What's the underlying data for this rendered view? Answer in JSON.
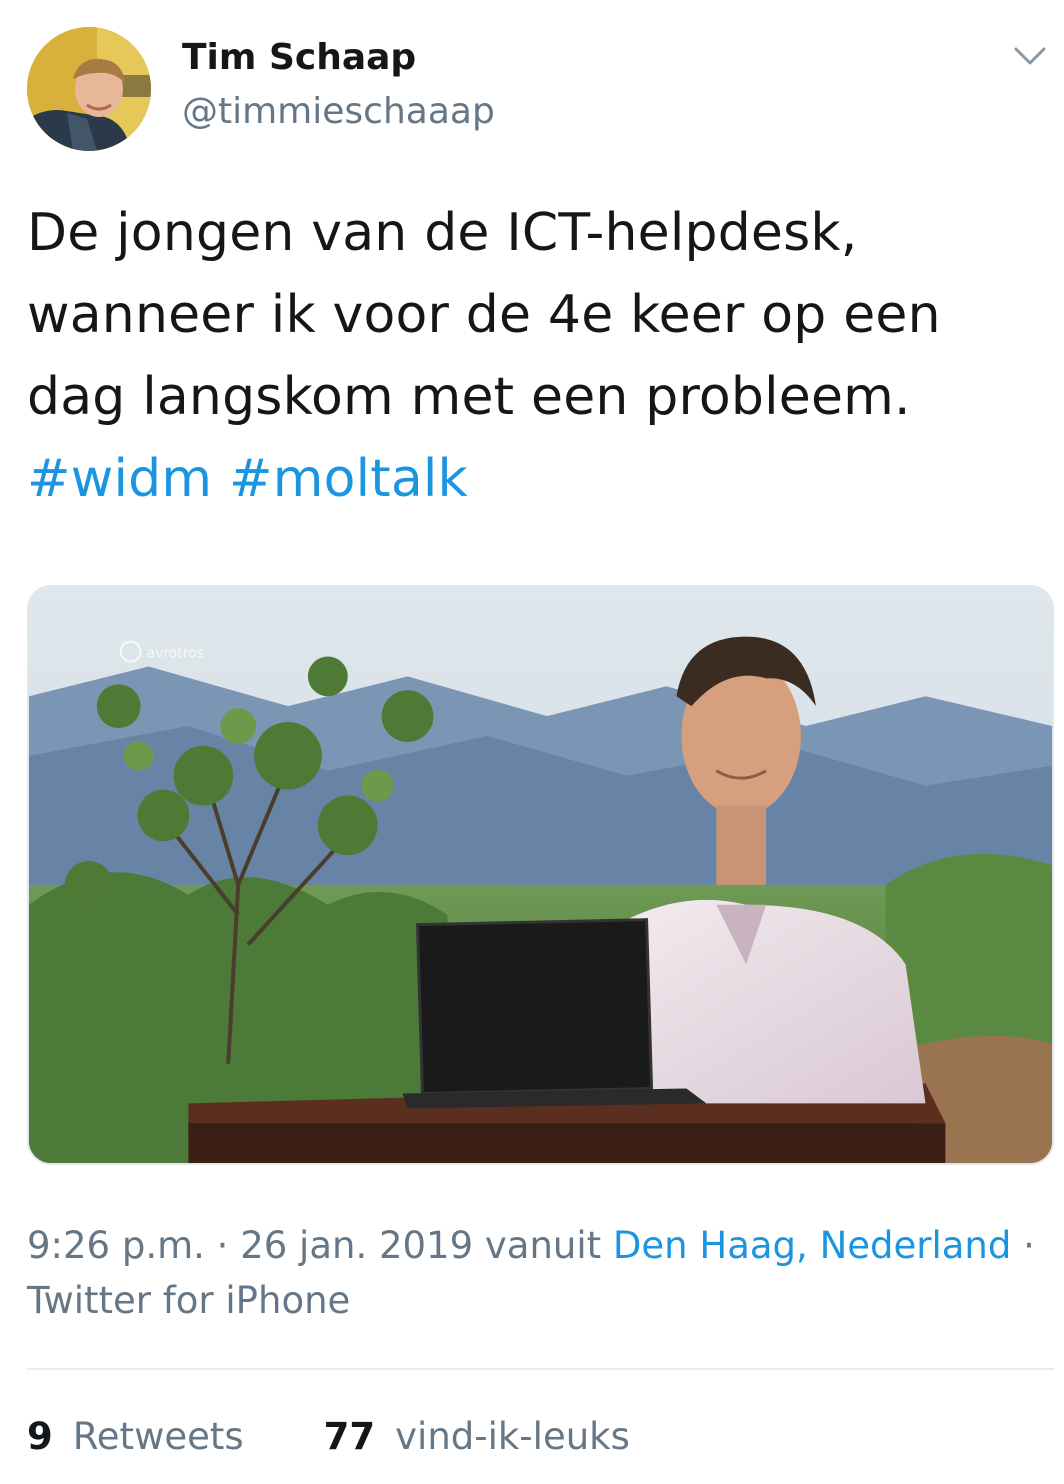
{
  "user": {
    "display_name": "Tim Schaap",
    "handle": "@timmieschaaap"
  },
  "tweet": {
    "text_lines": [
      "De jongen van de ICT-helpdesk,",
      "wanneer ik voor de 4e keer op een",
      "dag langskom met een probleem."
    ],
    "hashtags": [
      "#widm",
      "#moltalk"
    ],
    "media_watermark": "avrotros"
  },
  "meta": {
    "time": "9:26 p.m.",
    "separator": " · ",
    "date": "26 jan. 2019",
    "vanuit": " vanuit ",
    "location": "Den Haag, Nederland",
    "trailing_separator": " ·",
    "source": "Twitter for iPhone"
  },
  "stats": {
    "retweets_count": "9",
    "retweets_label": "Retweets",
    "likes_count": "77",
    "likes_label": "vind-ik-leuks"
  },
  "colors": {
    "text": "#14171a",
    "secondary": "#657786",
    "link": "#1b95e0",
    "divider": "#e6ecf0"
  },
  "icons": {
    "caret": "chevron-down-icon"
  }
}
